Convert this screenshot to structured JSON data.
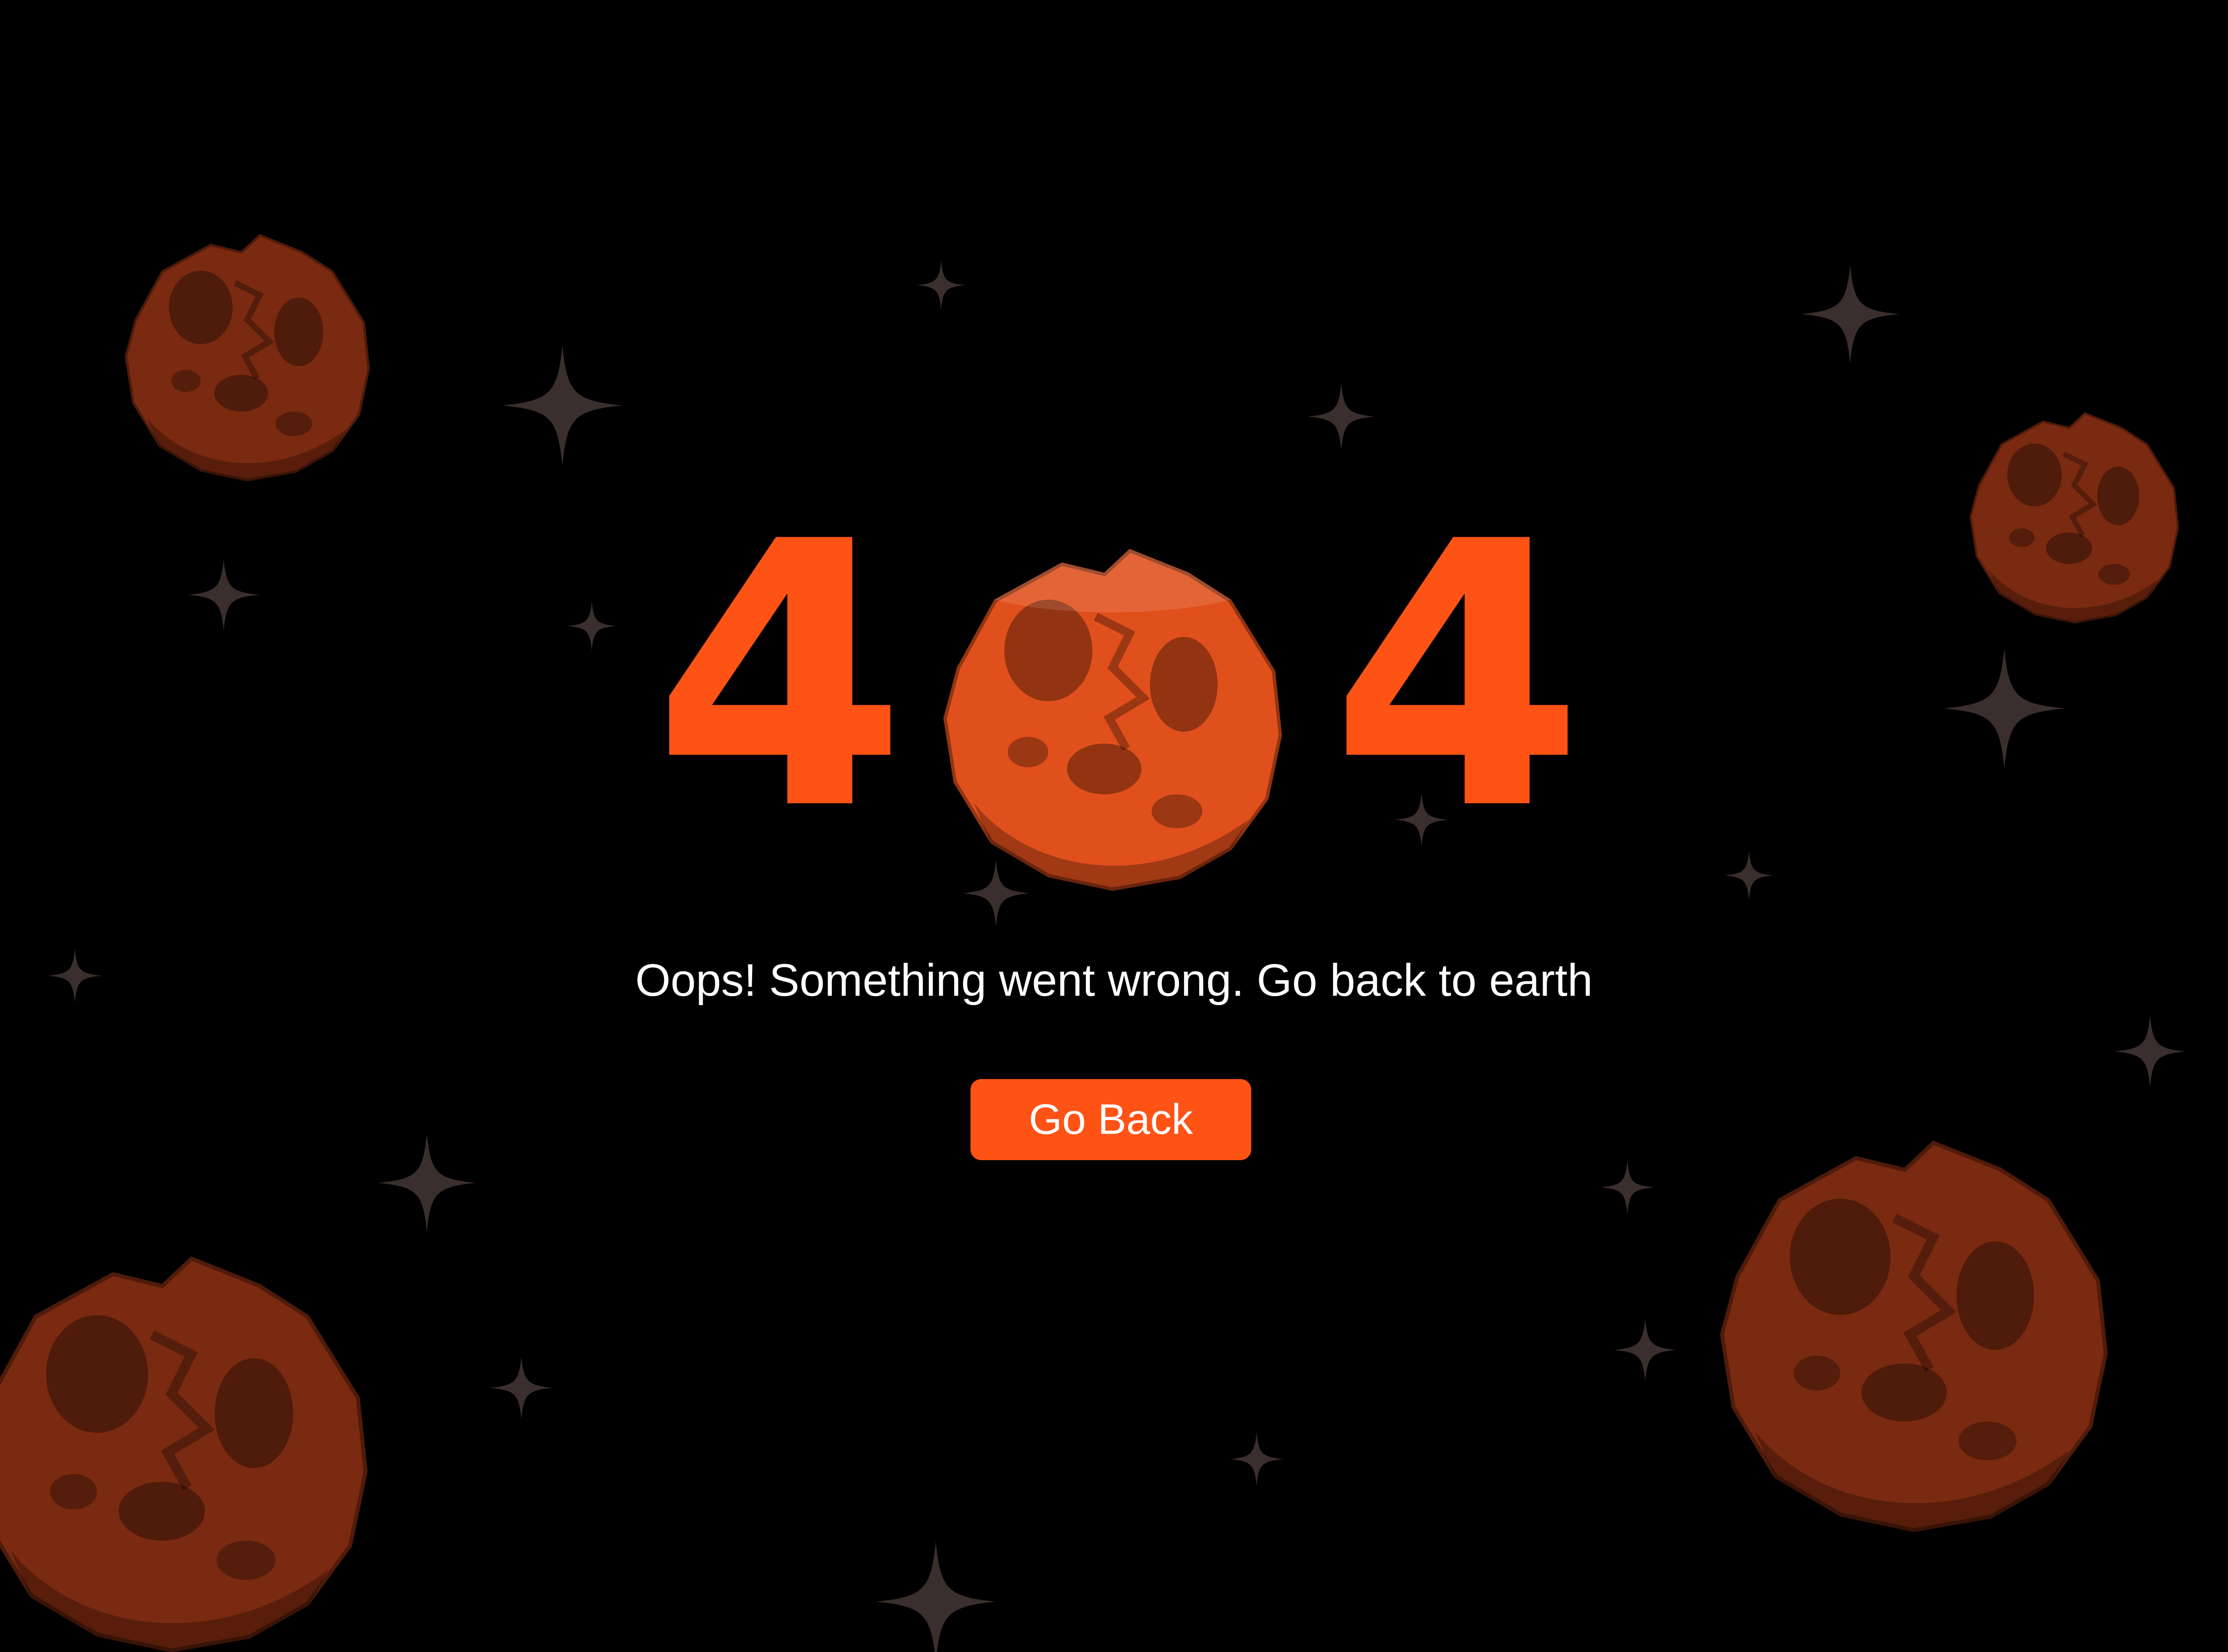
{
  "error": {
    "digit_left": "4",
    "digit_right": "4",
    "message": "Oops! Something went wrong. Go back to earth",
    "button_label": "Go Back"
  },
  "icons": {
    "center_planet": "asteroid-icon",
    "decor": [
      "asteroid-icon",
      "sparkle-star-icon"
    ]
  },
  "colors": {
    "background": "#000000",
    "accent": "#ff5316",
    "asteroid_dim": "#7a2a10",
    "star": "#3a2f2d",
    "text": "#ffffff"
  }
}
